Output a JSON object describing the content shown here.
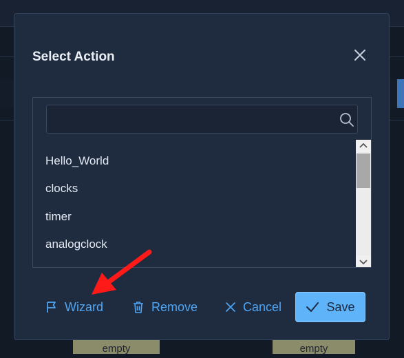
{
  "background": {
    "cells": [
      "empty",
      "empty"
    ]
  },
  "dialog": {
    "title": "Select Action",
    "search": {
      "value": "",
      "placeholder": ""
    },
    "actions": [
      "Hello_World",
      "clocks",
      "timer",
      "analogclock",
      "..."
    ],
    "buttons": {
      "wizard": "Wizard",
      "remove": "Remove",
      "cancel": "Cancel",
      "save": "Save"
    }
  },
  "icons": [
    "close-icon",
    "search-icon",
    "flag-icon",
    "trash-icon",
    "x-icon",
    "check-icon"
  ],
  "colors": {
    "accent": "#4fa6f5",
    "save_button": "#5fb3f8",
    "annotation_arrow": "#ff1a1a"
  }
}
